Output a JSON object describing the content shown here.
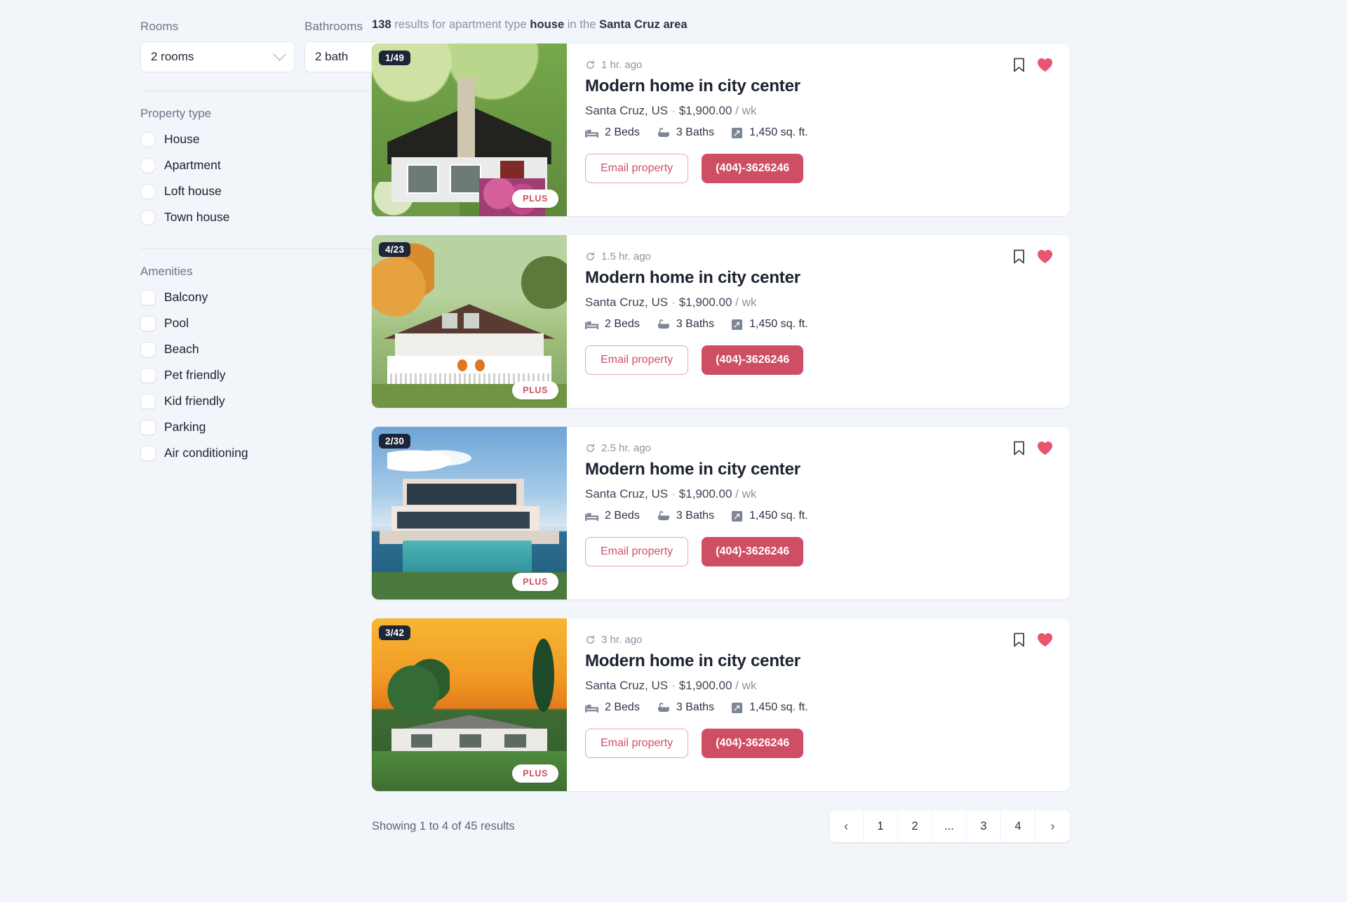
{
  "filters": {
    "rooms": {
      "label": "Rooms",
      "value": "2 rooms"
    },
    "bathrooms": {
      "label": "Bathrooms",
      "value": "2 bath"
    },
    "property_type": {
      "title": "Property type",
      "options": [
        {
          "label": "House",
          "selected": false
        },
        {
          "label": "Apartment",
          "selected": false
        },
        {
          "label": "Loft house",
          "selected": false
        },
        {
          "label": "Town house",
          "selected": false
        }
      ]
    },
    "amenities": {
      "title": "Amenities",
      "options": [
        {
          "label": "Balcony",
          "checked": false
        },
        {
          "label": "Pool",
          "checked": false
        },
        {
          "label": "Beach",
          "checked": false
        },
        {
          "label": "Pet friendly",
          "checked": false
        },
        {
          "label": "Kid friendly",
          "checked": false
        },
        {
          "label": "Parking",
          "checked": false
        },
        {
          "label": "Air conditioning",
          "checked": false
        }
      ]
    }
  },
  "results_header": {
    "count": "138",
    "text_1": " results for apartment type ",
    "type": "house",
    "text_2": " in the ",
    "area": "Santa Cruz area"
  },
  "listings": [
    {
      "photo_count": "1/49",
      "plus_badge": "PLUS",
      "time": "1 hr. ago",
      "title": "Modern home in city center",
      "location": "Santa Cruz, US",
      "price": "$1,900.00",
      "price_unit": "/ wk",
      "beds": "2 Beds",
      "baths": "3 Baths",
      "area": "1,450 sq. ft.",
      "email_label": "Email property",
      "phone_label": "(404)-3626246"
    },
    {
      "photo_count": "4/23",
      "plus_badge": "PLUS",
      "time": "1.5 hr. ago",
      "title": "Modern home in city center",
      "location": "Santa Cruz, US",
      "price": "$1,900.00",
      "price_unit": "/ wk",
      "beds": "2 Beds",
      "baths": "3 Baths",
      "area": "1,450 sq. ft.",
      "email_label": "Email property",
      "phone_label": "(404)-3626246"
    },
    {
      "photo_count": "2/30",
      "plus_badge": "PLUS",
      "time": "2.5 hr. ago",
      "title": "Modern home in city center",
      "location": "Santa Cruz, US",
      "price": "$1,900.00",
      "price_unit": "/ wk",
      "beds": "2 Beds",
      "baths": "3 Baths",
      "area": "1,450 sq. ft.",
      "email_label": "Email property",
      "phone_label": "(404)-3626246"
    },
    {
      "photo_count": "3/42",
      "plus_badge": "PLUS",
      "time": "3 hr. ago",
      "title": "Modern home in city center",
      "location": "Santa Cruz, US",
      "price": "$1,900.00",
      "price_unit": "/ wk",
      "beds": "2 Beds",
      "baths": "3 Baths",
      "area": "1,450 sq. ft.",
      "email_label": "Email property",
      "phone_label": "(404)-3626246"
    }
  ],
  "footer": {
    "showing": "Showing 1 to 4 of 45 results",
    "pages": [
      "‹",
      "1",
      "2",
      "...",
      "3",
      "4",
      "›"
    ]
  },
  "colors": {
    "accent": "#ce4e64",
    "heart": "#e8556e",
    "badge_dark": "#1d2639",
    "page_bg": "#f2f5f9"
  }
}
